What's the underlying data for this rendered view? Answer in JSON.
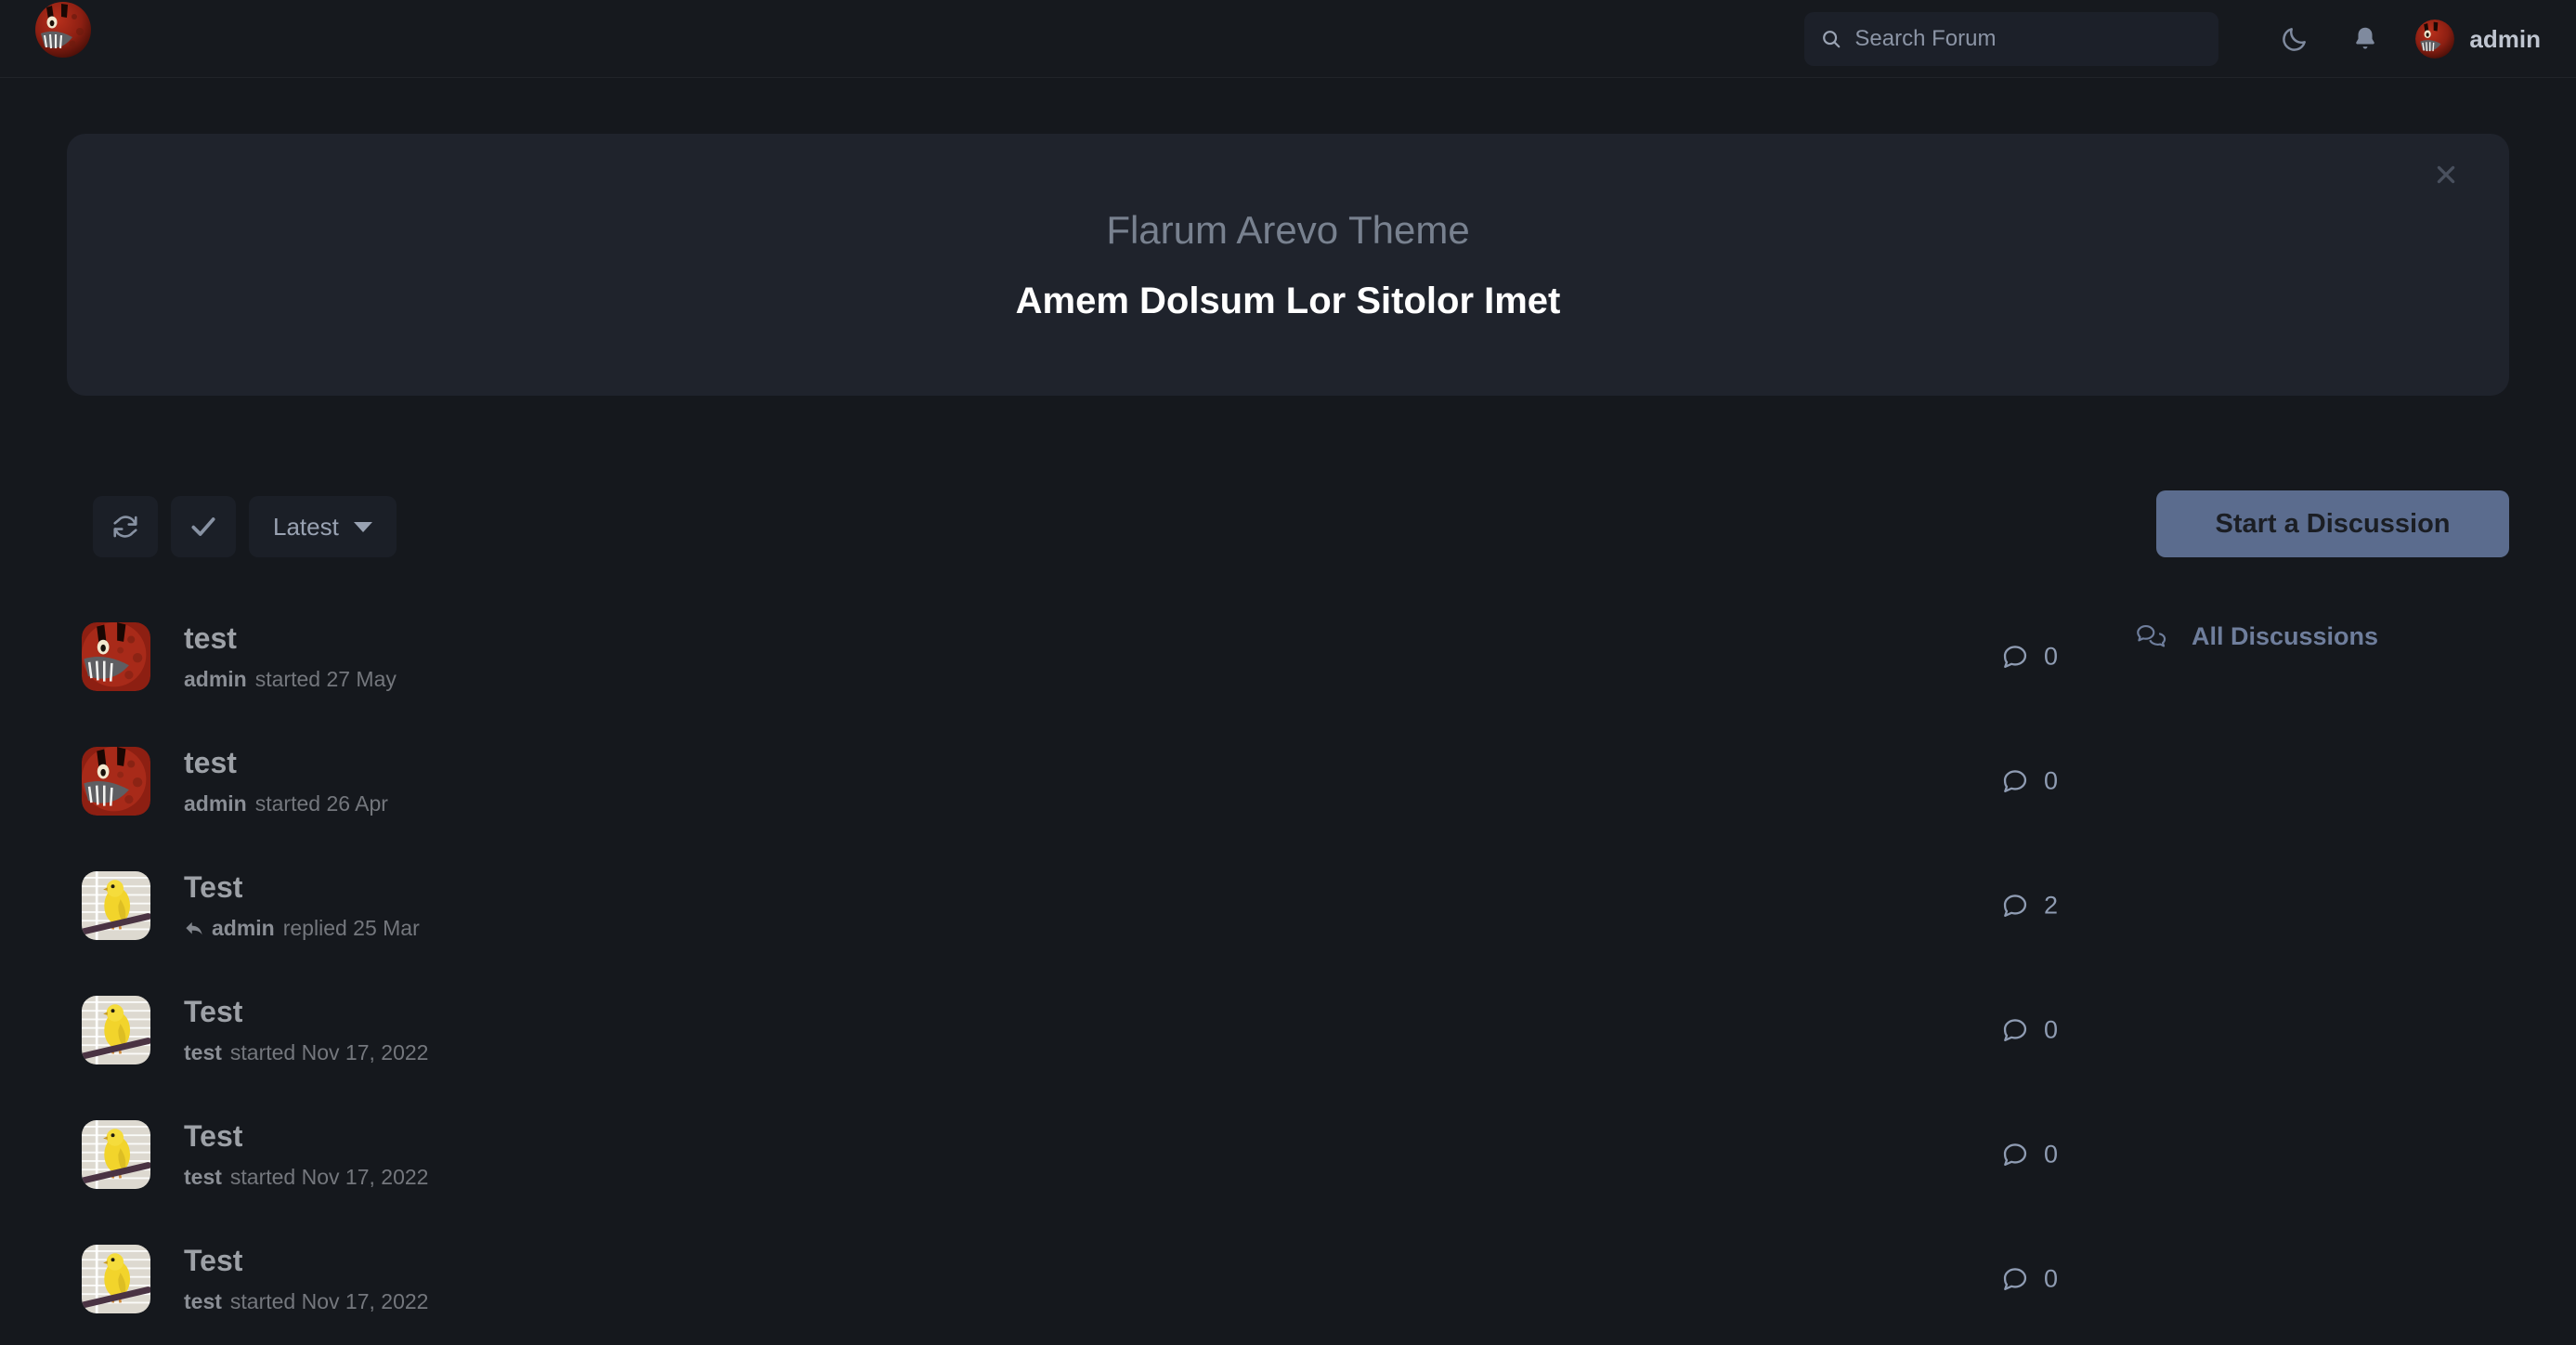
{
  "header": {
    "logo_icon": "forum-monster-logo",
    "search": {
      "placeholder": "Search Forum",
      "value": "",
      "icon": "search-icon"
    },
    "dark_mode_icon": "moon-icon",
    "notifications_icon": "bell-icon",
    "username": "admin",
    "avatar_icon": "user-avatar-monster"
  },
  "hero": {
    "title": "Flarum Arevo Theme",
    "subtitle": "Amem Dolsum Lor Sitolor Imet",
    "close_icon": "close-icon"
  },
  "toolbar": {
    "refresh_icon": "refresh-icon",
    "mark_read_icon": "check-icon",
    "sort_label": "Latest",
    "sort_caret_icon": "chevron-down-icon",
    "start_discussion_label": "Start a Discussion"
  },
  "sidebar": {
    "items": [
      {
        "label": "All Discussions",
        "icon": "discussions-bubbles-icon"
      }
    ]
  },
  "discussions": [
    {
      "title": "test",
      "author": "admin",
      "action": "started",
      "date": "27 May",
      "comments": "0",
      "avatar": "monster",
      "replied": false
    },
    {
      "title": "test",
      "author": "admin",
      "action": "started",
      "date": "26 Apr",
      "comments": "0",
      "avatar": "monster",
      "replied": false
    },
    {
      "title": "Test",
      "author": "admin",
      "action": "replied",
      "date": "25 Mar",
      "comments": "2",
      "avatar": "bird",
      "replied": true
    },
    {
      "title": "Test",
      "author": "test",
      "action": "started",
      "date": "Nov 17, 2022",
      "comments": "0",
      "avatar": "bird",
      "replied": false
    },
    {
      "title": "Test",
      "author": "test",
      "action": "started",
      "date": "Nov 17, 2022",
      "comments": "0",
      "avatar": "bird",
      "replied": false
    },
    {
      "title": "Test",
      "author": "test",
      "action": "started",
      "date": "Nov 17, 2022",
      "comments": "0",
      "avatar": "bird",
      "replied": false
    }
  ],
  "colors": {
    "page_background": "#15181d",
    "header_background": "#16191e",
    "hero_background": "#1f232c",
    "accent_button": "#5b6c8e",
    "muted_text": "#74777d",
    "title_text": "#9da1a7",
    "link_blue": "#6f7e9c"
  }
}
